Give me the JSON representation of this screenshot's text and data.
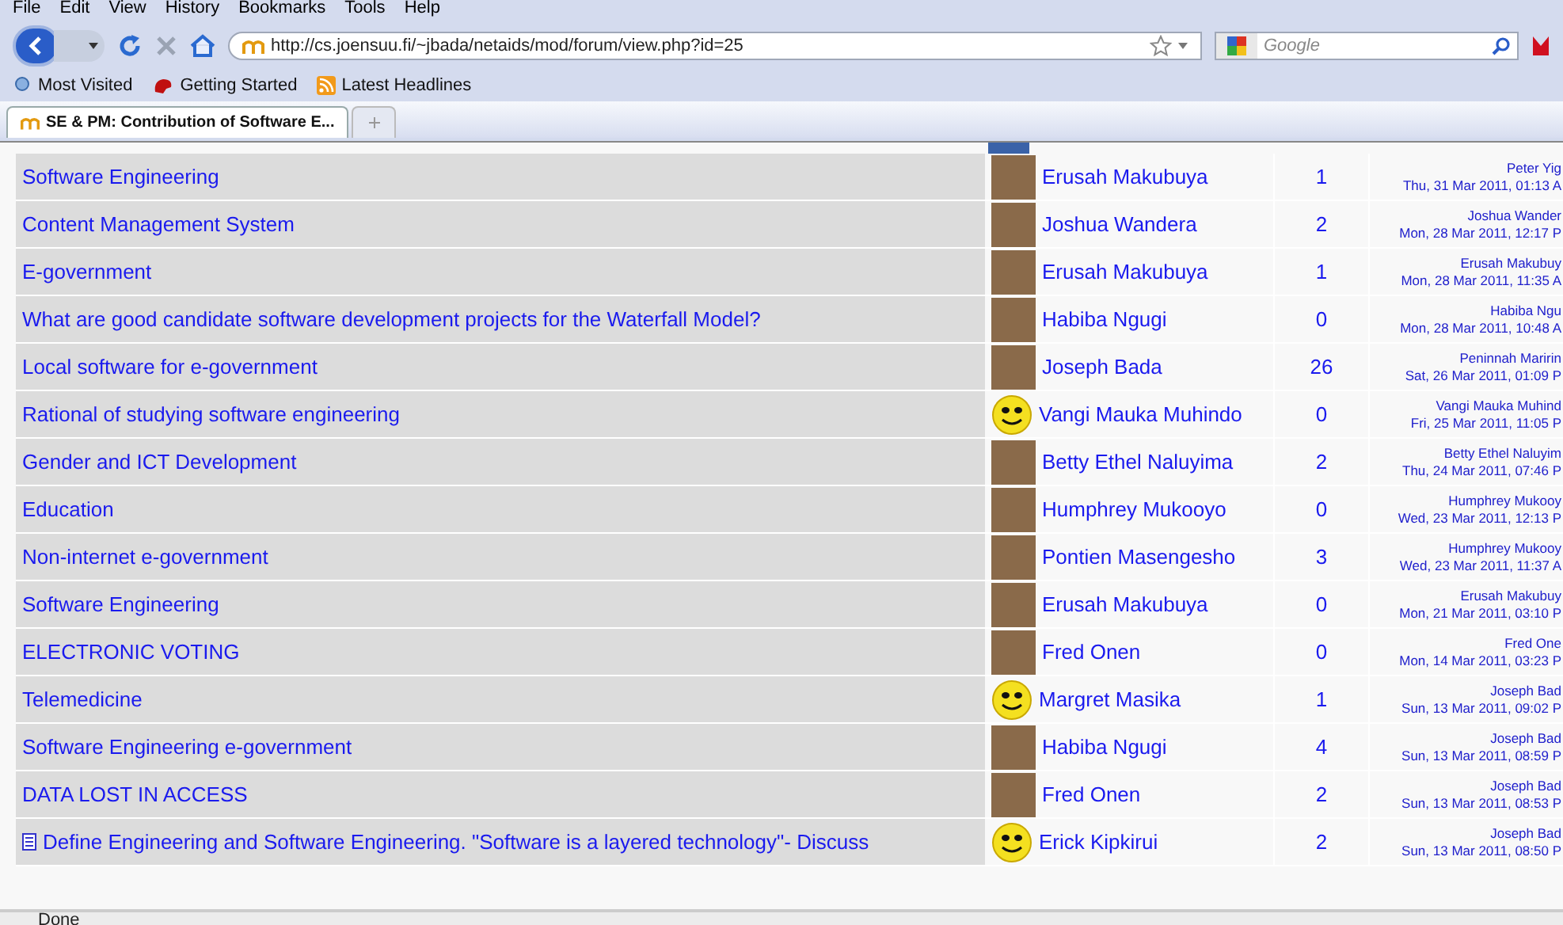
{
  "menu": [
    "File",
    "Edit",
    "View",
    "History",
    "Bookmarks",
    "Tools",
    "Help"
  ],
  "address": "http://cs.joensuu.fi/~jbada/netaids/mod/forum/view.php?id=25",
  "search": {
    "placeholder": "Google"
  },
  "bookmarks": [
    "Most Visited",
    "Getting Started",
    "Latest Headlines"
  ],
  "tabs": [
    {
      "label": "SE & PM: Contribution of Software E...",
      "selected": true
    }
  ],
  "rows": [
    {
      "topic": "Software Engineering",
      "kind": "photo",
      "author": "Erusah Makubuya",
      "replies": "1",
      "last_by": "Peter Yig",
      "last_date": "Thu, 31 Mar 2011, 01:13 A",
      "attachment": false
    },
    {
      "topic": "Content Management System",
      "kind": "photo",
      "author": "Joshua Wandera",
      "replies": "2",
      "last_by": "Joshua Wander",
      "last_date": "Mon, 28 Mar 2011, 12:17 P",
      "attachment": false
    },
    {
      "topic": "E-government",
      "kind": "photo",
      "author": "Erusah Makubuya",
      "replies": "1",
      "last_by": "Erusah Makubuy",
      "last_date": "Mon, 28 Mar 2011, 11:35 A",
      "attachment": false
    },
    {
      "topic": "What are good candidate software development projects for the Waterfall Model?",
      "kind": "photo",
      "author": "Habiba Ngugi",
      "replies": "0",
      "last_by": "Habiba Ngu",
      "last_date": "Mon, 28 Mar 2011, 10:48 A",
      "attachment": false
    },
    {
      "topic": "Local software for e-government",
      "kind": "photo",
      "author": "Joseph Bada",
      "replies": "26",
      "last_by": "Peninnah Maririn",
      "last_date": "Sat, 26 Mar 2011, 01:09 P",
      "attachment": false
    },
    {
      "topic": "Rational of studying software engineering",
      "kind": "smiley",
      "author": "Vangi Mauka Muhindo",
      "replies": "0",
      "last_by": "Vangi Mauka Muhind",
      "last_date": "Fri, 25 Mar 2011, 11:05 P",
      "attachment": false
    },
    {
      "topic": "Gender and ICT Development",
      "kind": "photo",
      "author": "Betty Ethel Naluyima",
      "replies": "2",
      "last_by": "Betty Ethel Naluyim",
      "last_date": "Thu, 24 Mar 2011, 07:46 P",
      "attachment": false
    },
    {
      "topic": "Education",
      "kind": "photo",
      "author": "Humphrey Mukooyo",
      "replies": "0",
      "last_by": "Humphrey Mukooy",
      "last_date": "Wed, 23 Mar 2011, 12:13 P",
      "attachment": false
    },
    {
      "topic": "Non-internet e-government",
      "kind": "photo",
      "author": "Pontien Masengesho",
      "replies": "3",
      "last_by": "Humphrey Mukooy",
      "last_date": "Wed, 23 Mar 2011, 11:37 A",
      "attachment": false
    },
    {
      "topic": "Software Engineering",
      "kind": "photo",
      "author": "Erusah Makubuya",
      "replies": "0",
      "last_by": "Erusah Makubuy",
      "last_date": "Mon, 21 Mar 2011, 03:10 P",
      "attachment": false
    },
    {
      "topic": "ELECTRONIC VOTING",
      "kind": "photo",
      "author": "Fred Onen",
      "replies": "0",
      "last_by": "Fred One",
      "last_date": "Mon, 14 Mar 2011, 03:23 P",
      "attachment": false
    },
    {
      "topic": "Telemedicine",
      "kind": "smiley",
      "author": "Margret Masika",
      "replies": "1",
      "last_by": "Joseph Bad",
      "last_date": "Sun, 13 Mar 2011, 09:02 P",
      "attachment": false
    },
    {
      "topic": "Software Engineering e-government",
      "kind": "photo",
      "author": "Habiba Ngugi",
      "replies": "4",
      "last_by": "Joseph Bad",
      "last_date": "Sun, 13 Mar 2011, 08:59 P",
      "attachment": false
    },
    {
      "topic": "DATA LOST IN ACCESS",
      "kind": "photo",
      "author": "Fred Onen",
      "replies": "2",
      "last_by": "Joseph Bad",
      "last_date": "Sun, 13 Mar 2011, 08:53 P",
      "attachment": false
    },
    {
      "topic": "Define Engineering and Software Engineering. \"Software is a layered technology\"- Discuss",
      "kind": "smiley",
      "author": "Erick Kipkirui",
      "replies": "2",
      "last_by": "Joseph Bad",
      "last_date": "Sun, 13 Mar 2011, 08:50 P",
      "attachment": true
    }
  ],
  "status_bar": "Done"
}
